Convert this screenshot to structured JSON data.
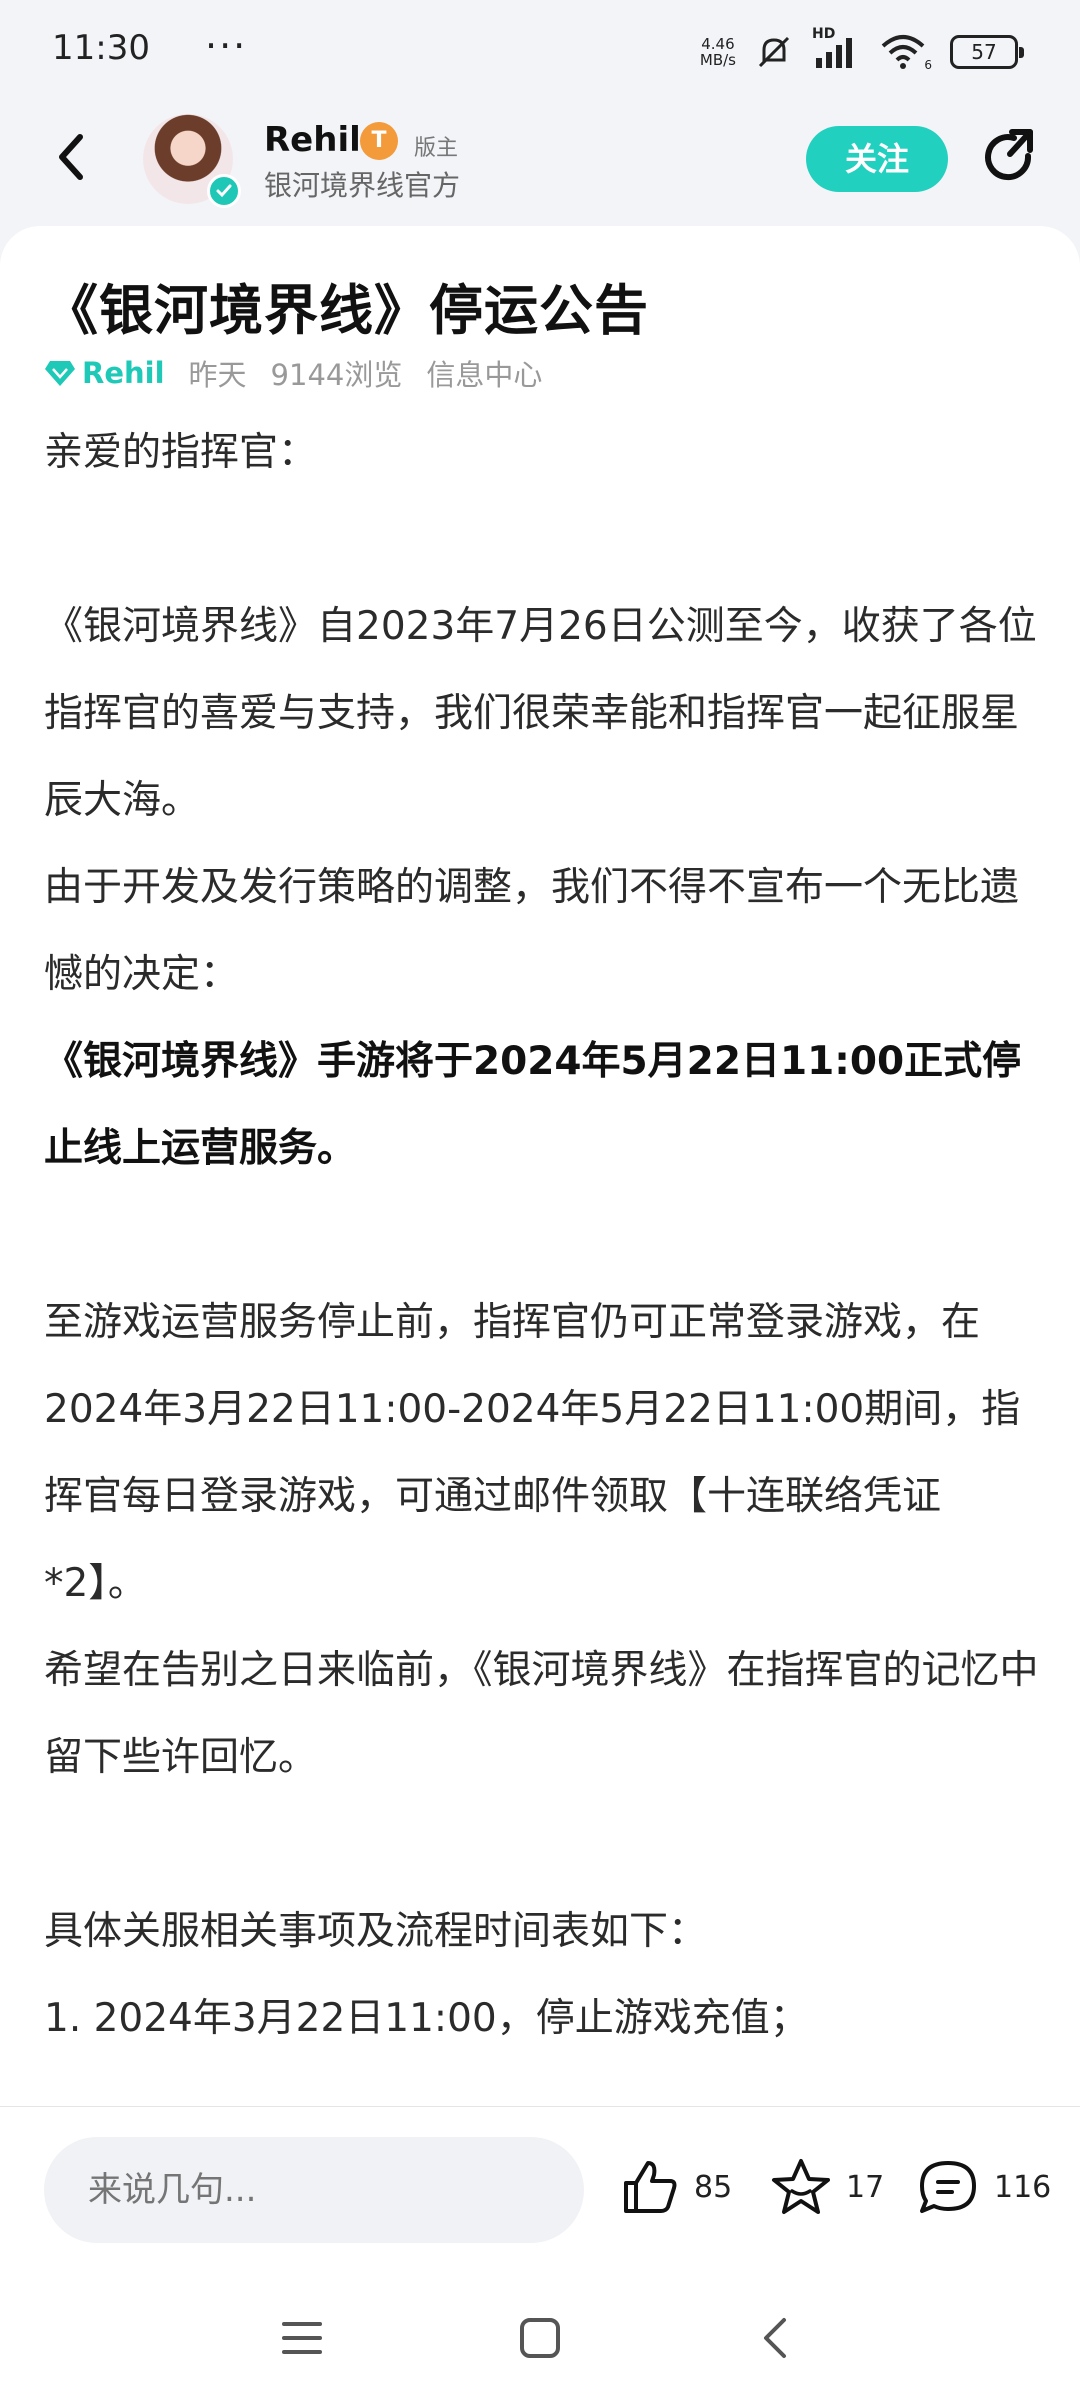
{
  "status_bar": {
    "time": "11:30",
    "dots": "···",
    "net_speed_value": "4.46",
    "net_speed_unit": "MB/s",
    "signal_label": "HD",
    "wifi_label": "6",
    "battery": "57"
  },
  "header": {
    "author_name": "Rehil",
    "level_badge": "T",
    "role_tag": "版主",
    "author_org": "银河境界线官方",
    "follow_label": "关注"
  },
  "post": {
    "title": "《银河境界线》停运公告",
    "meta_author": "Rehil",
    "meta_time": "昨天",
    "meta_views": "9144浏览",
    "meta_category": "信息中心",
    "paragraphs": [
      "亲爱的指挥官：",
      "《银河境界线》自2023年7月26日公测至今，收获了各位指挥官的喜爱与支持，我们很荣幸能和指挥官一起征服星辰大海。",
      "由于开发及发行策略的调整，我们不得不宣布一个无比遗憾的决定：",
      "《银河境界线》手游将于2024年5月22日11:00正式停止线上运营服务。",
      "至游戏运营服务停止前，指挥官仍可正常登录游戏，在2024年3月22日11:00-2024年5月22日11:00期间，指挥官每日登录游戏，可通过邮件领取【十连联络凭证*2】。",
      "希望在告别之日来临前，《银河境界线》在指挥官的记忆中留下些许回忆。",
      "具体关服相关事项及流程时间表如下：",
      "1. 2024年3月22日11:00，停止游戏充值；"
    ]
  },
  "bottom_bar": {
    "comment_placeholder": "来说几句...",
    "likes": "85",
    "favorites": "17",
    "comments": "116"
  },
  "colors": {
    "accent": "#22d0bf",
    "background": "#f3f4f8",
    "level_badge": "#f39a3b"
  },
  "icons": [
    "back-icon",
    "verified-icon",
    "share-icon",
    "diamond-icon",
    "like-icon",
    "star-icon",
    "comment-icon",
    "menu-icon",
    "home-icon",
    "nav-back-icon"
  ]
}
